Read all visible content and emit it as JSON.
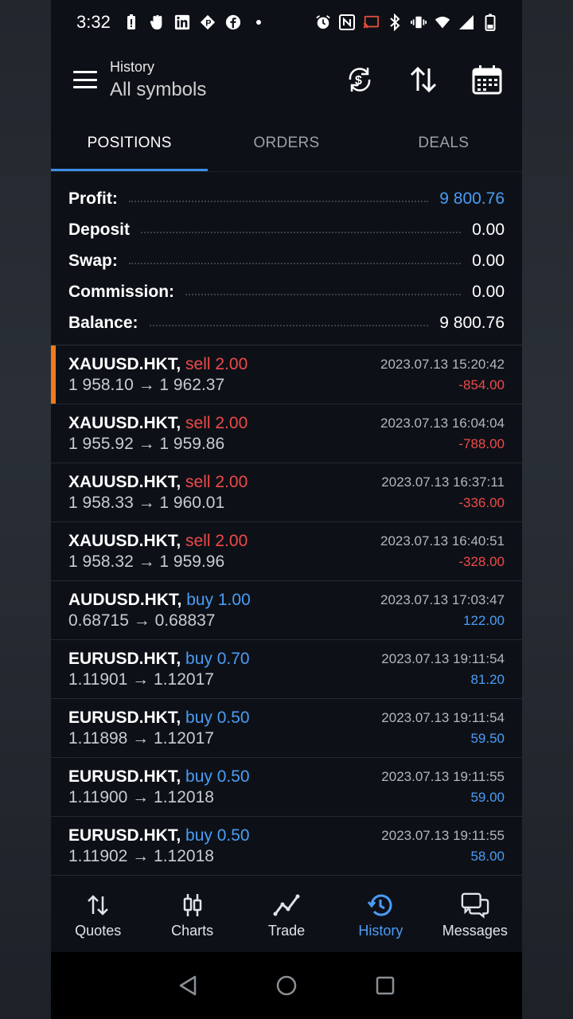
{
  "status_bar": {
    "time": "3:32"
  },
  "app_bar": {
    "title": "History",
    "subtitle": "All symbols"
  },
  "tabs": [
    {
      "label": "POSITIONS",
      "active": true
    },
    {
      "label": "ORDERS",
      "active": false
    },
    {
      "label": "DEALS",
      "active": false
    }
  ],
  "summary": {
    "profit": {
      "label": "Profit:",
      "value": "9 800.76"
    },
    "deposit": {
      "label": "Deposit",
      "value": "0.00"
    },
    "swap": {
      "label": "Swap:",
      "value": "0.00"
    },
    "commission": {
      "label": "Commission:",
      "value": "0.00"
    },
    "balance": {
      "label": "Balance:",
      "value": "9 800.76"
    }
  },
  "deals": [
    {
      "symbol": "XAUUSD.HKT,",
      "type": "sell 2.00",
      "side": "sell",
      "prices": "1 958.10 → 1 962.37",
      "time": "2023.07.13 15:20:42",
      "profit": "-854.00"
    },
    {
      "symbol": "XAUUSD.HKT,",
      "type": "sell 2.00",
      "side": "sell",
      "prices": "1 955.92 → 1 959.86",
      "time": "2023.07.13 16:04:04",
      "profit": "-788.00"
    },
    {
      "symbol": "XAUUSD.HKT,",
      "type": "sell 2.00",
      "side": "sell",
      "prices": "1 958.33 → 1 960.01",
      "time": "2023.07.13 16:37:11",
      "profit": "-336.00"
    },
    {
      "symbol": "XAUUSD.HKT,",
      "type": "sell 2.00",
      "side": "sell",
      "prices": "1 958.32 → 1 959.96",
      "time": "2023.07.13 16:40:51",
      "profit": "-328.00"
    },
    {
      "symbol": "AUDUSD.HKT,",
      "type": "buy 1.00",
      "side": "buy",
      "prices": "0.68715 → 0.68837",
      "time": "2023.07.13 17:03:47",
      "profit": "122.00"
    },
    {
      "symbol": "EURUSD.HKT,",
      "type": "buy 0.70",
      "side": "buy",
      "prices": "1.11901 → 1.12017",
      "time": "2023.07.13 19:11:54",
      "profit": "81.20"
    },
    {
      "symbol": "EURUSD.HKT,",
      "type": "buy 0.50",
      "side": "buy",
      "prices": "1.11898 → 1.12017",
      "time": "2023.07.13 19:11:54",
      "profit": "59.50"
    },
    {
      "symbol": "EURUSD.HKT,",
      "type": "buy 0.50",
      "side": "buy",
      "prices": "1.11900 → 1.12018",
      "time": "2023.07.13 19:11:55",
      "profit": "59.00"
    },
    {
      "symbol": "EURUSD.HKT,",
      "type": "buy 0.50",
      "side": "buy",
      "prices": "1.11902 → 1.12018",
      "time": "2023.07.13 19:11:55",
      "profit": "58.00"
    }
  ],
  "bottom_nav": [
    {
      "label": "Quotes",
      "icon": "quotes-icon",
      "active": false
    },
    {
      "label": "Charts",
      "icon": "charts-icon",
      "active": false
    },
    {
      "label": "Trade",
      "icon": "trade-icon",
      "active": false
    },
    {
      "label": "History",
      "icon": "history-icon",
      "active": true
    },
    {
      "label": "Messages",
      "icon": "messages-icon",
      "active": false
    }
  ],
  "colors": {
    "accent": "#4a9cf5",
    "sell": "#f0494a",
    "buy": "#4a9cf5",
    "highlight": "#f07b1c",
    "background": "#0d1117"
  }
}
